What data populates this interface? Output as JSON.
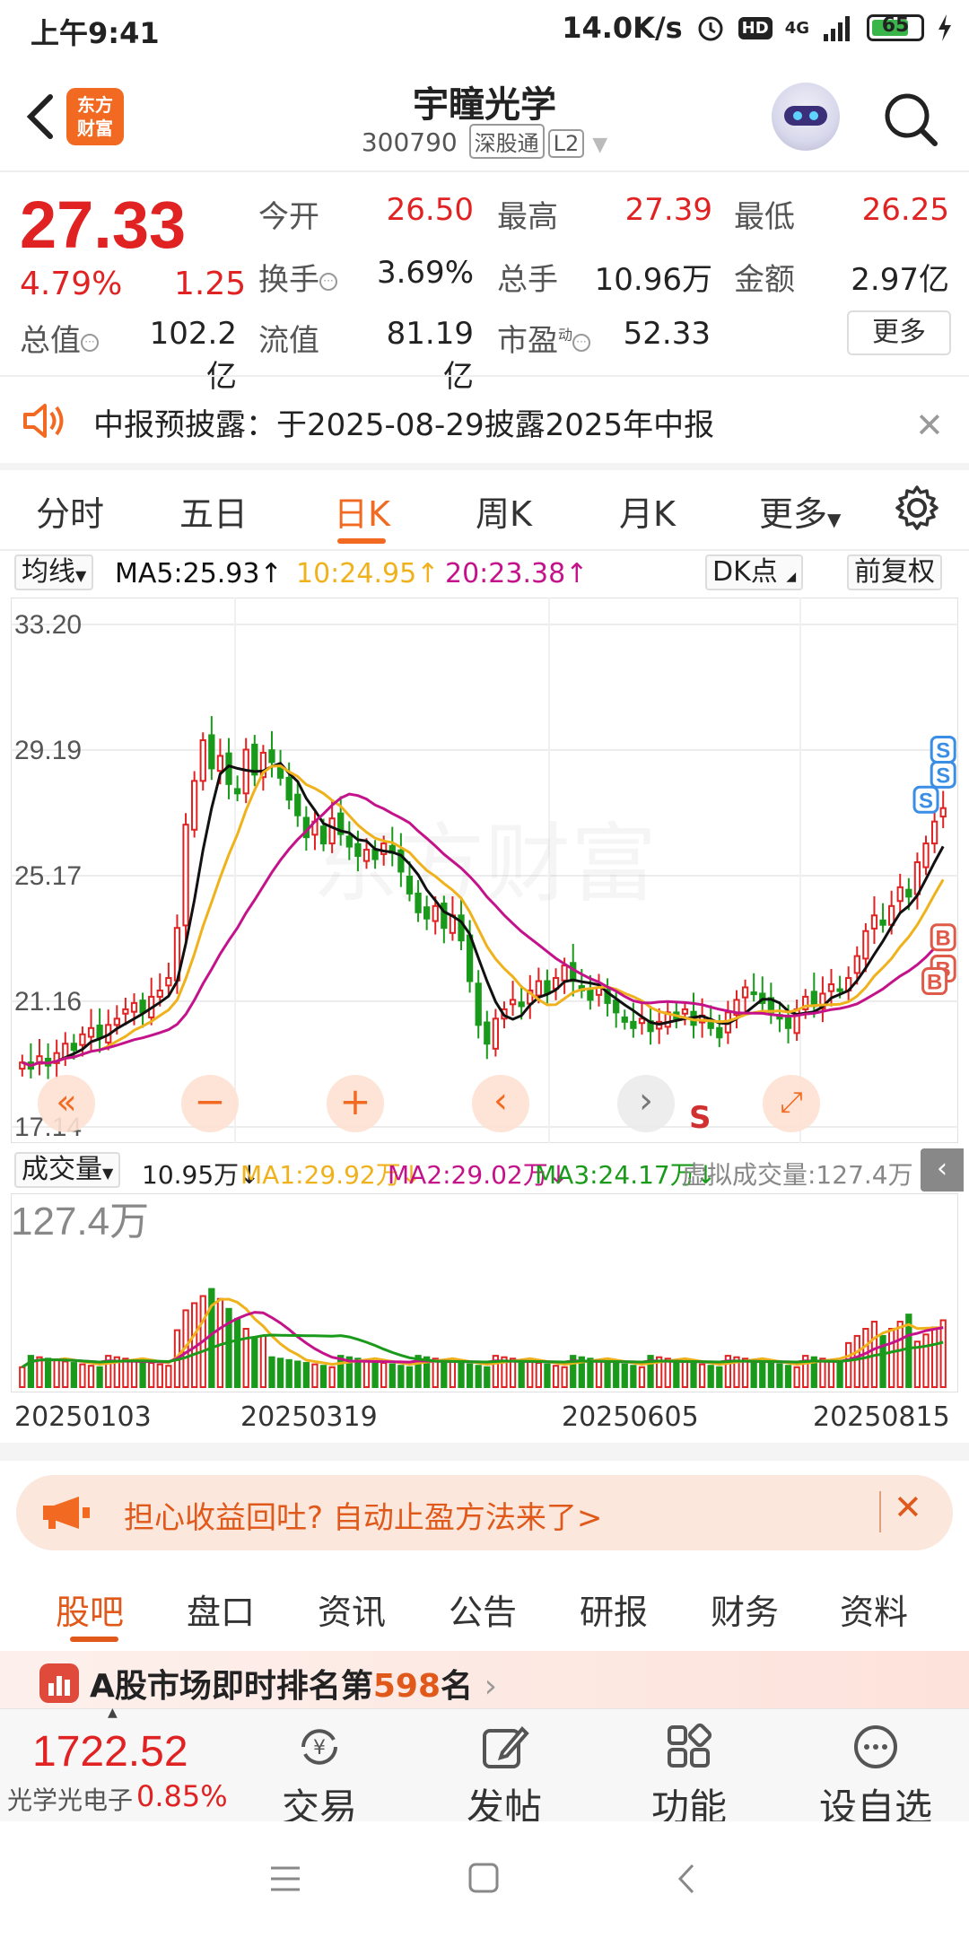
{
  "status_bar": {
    "time": "上午9:41",
    "net_speed": "14.0K/s",
    "hd": "HD",
    "net": "4G",
    "battery": "65"
  },
  "header": {
    "name": "宇瞳光学",
    "code": "300790",
    "tag1": "深股通",
    "tag2": "L2",
    "logo_line1": "东方",
    "logo_line2": "财富"
  },
  "quote": {
    "price": "27.33",
    "change_pct": "4.79%",
    "change": "1.25",
    "open_label": "今开",
    "open": "26.50",
    "high_label": "最高",
    "high": "27.39",
    "low_label": "最低",
    "low": "26.25",
    "turnover_label": "换手",
    "turnover": "3.69%",
    "volume_label": "总手",
    "volume": "10.96万",
    "amount_label": "金额",
    "amount": "2.97亿",
    "mktcap_label": "总值",
    "mktcap": "102.2亿",
    "float_label": "流值",
    "float": "81.19亿",
    "pe_label": "市盈",
    "pe_sup": "动",
    "pe": "52.33",
    "more": "更多"
  },
  "notice": {
    "text": "中报预披露：于2025-08-29披露2025年中报"
  },
  "tabs": [
    "分时",
    "五日",
    "日K",
    "周K",
    "月K",
    "更多"
  ],
  "active_tab": "日K",
  "ma_bar": {
    "btn": "均线",
    "ma5": "MA5:25.93",
    "ma10": "10:24.95",
    "ma20": "20:23.38",
    "dk": "DK点",
    "adjust": "前复权"
  },
  "colors": {
    "up": "#e02222",
    "down": "#1a9a1a",
    "ma5": "#111111",
    "ma10": "#f0b21c",
    "ma20": "#c4138a",
    "accent": "#f26a21"
  },
  "chart_data": {
    "type": "candlestick",
    "y_ticks": [
      "33.20",
      "29.19",
      "25.17",
      "21.16",
      "17.14"
    ],
    "ylim": [
      17.14,
      33.2
    ],
    "x_labels": [
      "20250103",
      "20250319",
      "20250605",
      "20250815"
    ],
    "watermark": "东方财富",
    "closes": [
      19.2,
      19.0,
      19.4,
      19.1,
      19.5,
      19.8,
      19.6,
      20.1,
      20.3,
      20.0,
      20.4,
      20.6,
      20.9,
      21.1,
      20.8,
      21.3,
      21.5,
      21.9,
      23.5,
      26.8,
      28.2,
      29.5,
      28.6,
      29.0,
      28.1,
      27.8,
      29.2,
      28.4,
      29.1,
      28.8,
      28.3,
      27.6,
      27.1,
      26.4,
      26.9,
      26.2,
      27.0,
      26.5,
      26.1,
      25.8,
      26.0,
      25.7,
      26.2,
      25.9,
      25.3,
      24.6,
      24.0,
      23.8,
      24.2,
      23.5,
      23.9,
      23.1,
      21.8,
      20.4,
      19.8,
      20.6,
      20.9,
      21.2,
      21.0,
      21.5,
      21.8,
      21.4,
      21.9,
      22.3,
      21.8,
      21.5,
      21.2,
      21.6,
      21.1,
      20.8,
      20.5,
      20.3,
      20.6,
      20.2,
      20.5,
      20.8,
      20.6,
      20.9,
      20.4,
      20.7,
      20.3,
      20.0,
      20.8,
      21.2,
      21.6,
      21.4,
      21.1,
      20.8,
      20.6,
      20.3,
      20.9,
      21.3,
      21.0,
      21.4,
      21.7,
      21.5,
      21.9,
      22.6,
      23.4,
      23.9,
      23.6,
      24.2,
      24.8,
      24.5,
      25.6,
      26.2,
      26.9,
      27.33
    ],
    "ma5_last": 25.93,
    "ma10_last": 24.95,
    "ma20_last": 23.38,
    "volume": {
      "label": "成交量",
      "current": "10.95万",
      "ma1": "MA1:29.92万",
      "ma2": "MA2:29.02万",
      "ma3": "MA3:24.17万",
      "virtual": "虚拟成交量:127.4万",
      "max_label": "127.4万"
    },
    "signals": {
      "sell": "S",
      "buy": "B"
    }
  },
  "ad": {
    "text": "担心收益回吐? 自动止盈方法来了>"
  },
  "subtabs": [
    "股吧",
    "盘口",
    "资讯",
    "公告",
    "研报",
    "财务",
    "资料"
  ],
  "rank_strip": {
    "prefix": "A股市场即时排名第",
    "rank": "598",
    "suffix": "名"
  },
  "bottom": {
    "index_value": "1722.52",
    "index_name": "光学光电子",
    "index_pct": "0.85%",
    "items": [
      "交易",
      "发帖",
      "功能",
      "设自选"
    ]
  }
}
